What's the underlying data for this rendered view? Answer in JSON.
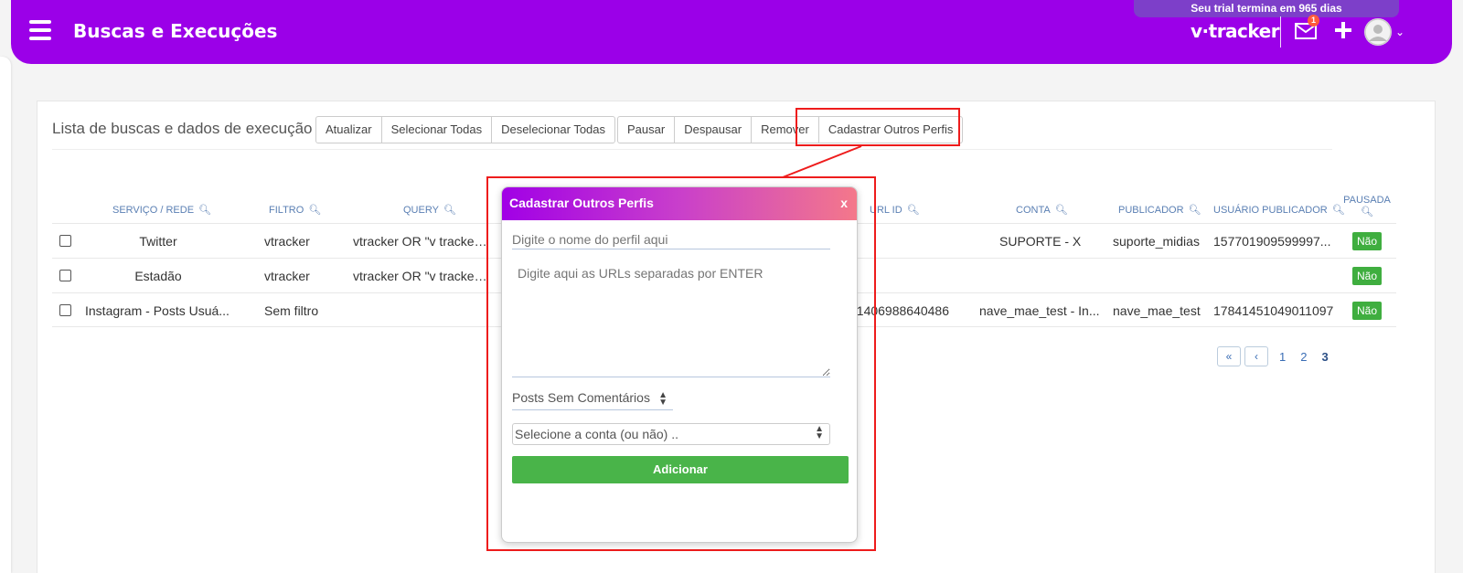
{
  "header": {
    "title": "Buscas e Execuções",
    "trial_text": "Seu trial termina em 965 dias",
    "brand": "v·tracker",
    "notification_count": "1"
  },
  "toolbar": {
    "list_title": "Lista de buscas e dados de execução",
    "group1": [
      "Atualizar",
      "Selecionar Todas",
      "Deselecionar Todas"
    ],
    "group2": [
      "Pausar",
      "Despausar",
      "Remover",
      "Cadastrar Outros Perfis"
    ]
  },
  "table": {
    "columns": [
      "SERVIÇO / REDE",
      "FILTRO",
      "QUERY",
      "URL ID",
      "CONTA",
      "PUBLICADOR",
      "USUÁRIO PUBLICADOR",
      "PAUSADA"
    ],
    "rows": [
      {
        "servico": "Twitter",
        "filtro": "vtracker",
        "query": "vtracker OR \"v tracker\" ...",
        "url_id": "",
        "conta": "SUPORTE - X",
        "publicador": "suporte_midias",
        "usuario": "157701909599997...",
        "pausada": "Não"
      },
      {
        "servico": "Estadão",
        "filtro": "vtracker",
        "query": "vtracker OR \"v tracker\" ...",
        "url_id": "",
        "conta": "",
        "publicador": "",
        "usuario": "",
        "pausada": "Não"
      },
      {
        "servico": "Instagram - Posts Usuá...",
        "filtro": "Sem filtro",
        "query": "",
        "url_id": "41406988640486",
        "conta": "nave_mae_test - In...",
        "publicador": "nave_mae_test",
        "usuario": "17841451049011097",
        "pausada": "Não"
      }
    ]
  },
  "pagination": {
    "first": "«",
    "prev": "‹",
    "pages": [
      "1",
      "2",
      "3"
    ]
  },
  "modal": {
    "title": "Cadastrar Outros Perfis",
    "close": "x",
    "name_placeholder": "Digite o nome do perfil aqui",
    "urls_placeholder": "Digite aqui as URLs separadas por ENTER",
    "posts_select": "Posts Sem Comentários",
    "account_select": "Selecione a conta (ou não) ..",
    "add_button": "Adicionar"
  },
  "colors": {
    "header_bg": "#9b00e8",
    "highlight": "#ee1c1c",
    "success": "#49b449"
  }
}
